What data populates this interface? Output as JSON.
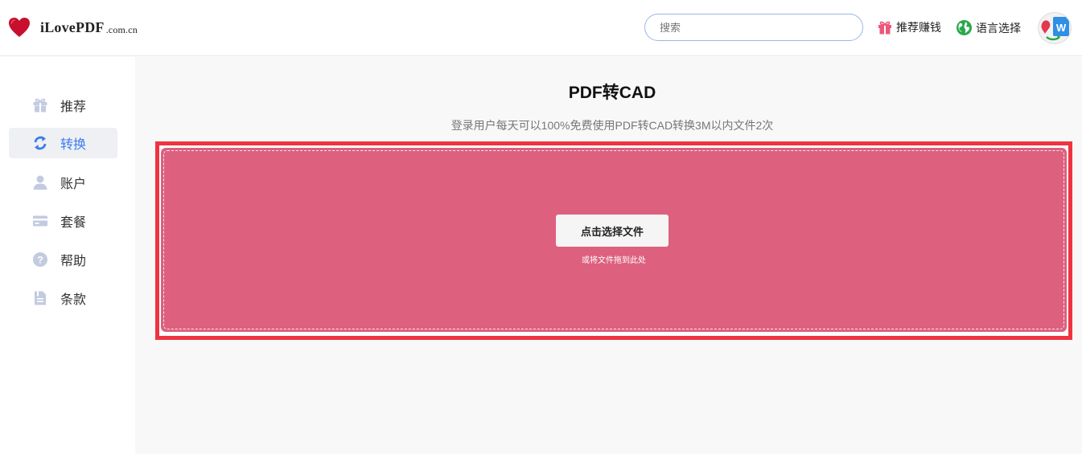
{
  "header": {
    "logo_text": "iLovePDF",
    "logo_suffix": ".com.cn",
    "search_placeholder": "搜索",
    "referral_label": "推荐赚钱",
    "language_label": "语言选择"
  },
  "sidebar": {
    "items": [
      {
        "label": "推荐",
        "icon": "gift-icon",
        "active": false
      },
      {
        "label": "转换",
        "icon": "convert-icon",
        "active": true
      },
      {
        "label": "账户",
        "icon": "user-icon",
        "active": false
      },
      {
        "label": "套餐",
        "icon": "card-icon",
        "active": false
      },
      {
        "label": "帮助",
        "icon": "help-icon",
        "active": false
      },
      {
        "label": "条款",
        "icon": "document-icon",
        "active": false
      }
    ]
  },
  "main": {
    "title": "PDF转CAD",
    "subtitle": "登录用户每天可以100%免费使用PDF转CAD转换3M以内文件2次",
    "choose_button_label": "点击选择文件",
    "drop_hint": "或将文件拖到此处"
  },
  "colors": {
    "accent": "#3b7bf0",
    "drop_zone": "#dd607f",
    "drop_frame": "#ef3340",
    "logo_heart": "#c8102e"
  }
}
